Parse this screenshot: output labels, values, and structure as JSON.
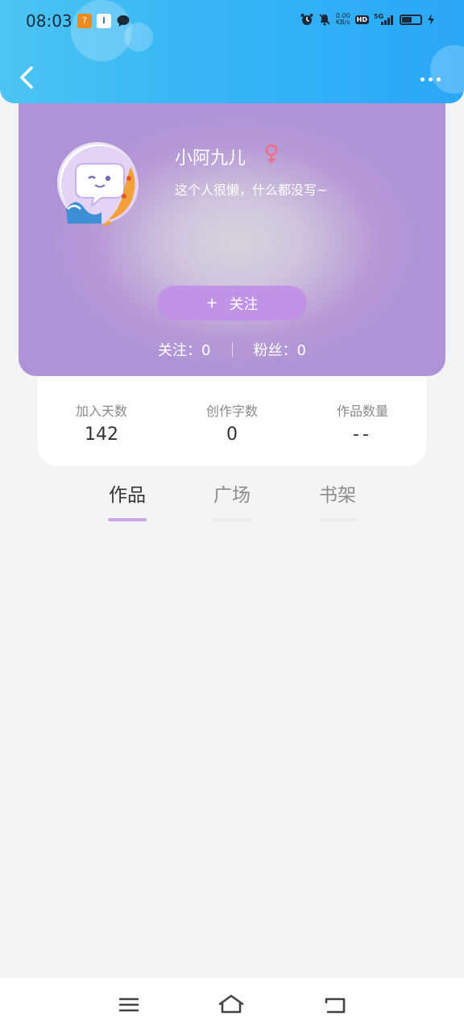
{
  "status_bar": {
    "time": "08:03",
    "net_speed_value": "0.00",
    "net_speed_unit": "KB/s",
    "hd_label": "HD",
    "network": "5G",
    "battery_level": 0.55
  },
  "header": {
    "back_icon": "chevron-left-icon",
    "more_icon": "more-dots-icon"
  },
  "profile": {
    "username": "小阿九儿",
    "gender_symbol": "♀",
    "bio": "这个人很懒，什么都没写~",
    "follow_button": "关注",
    "follow_plus": "+",
    "following_label": "关注：",
    "following_count": "0",
    "followers_label": "粉丝：",
    "followers_count": "0"
  },
  "stats": [
    {
      "label": "加入天数",
      "value": "142"
    },
    {
      "label": "创作字数",
      "value": "0"
    },
    {
      "label": "作品数量",
      "value": "--"
    }
  ],
  "tabs": [
    {
      "label": "作品",
      "active": true
    },
    {
      "label": "广场",
      "active": false
    },
    {
      "label": "书架",
      "active": false
    }
  ],
  "colors": {
    "accent": "#c193e6",
    "tab_active": "#333333",
    "tab_inactive": "#8c8c8c",
    "underline_active": "#c9a6e6",
    "underline_inactive": "#eeeeee",
    "gender": "#ef6f8a"
  }
}
